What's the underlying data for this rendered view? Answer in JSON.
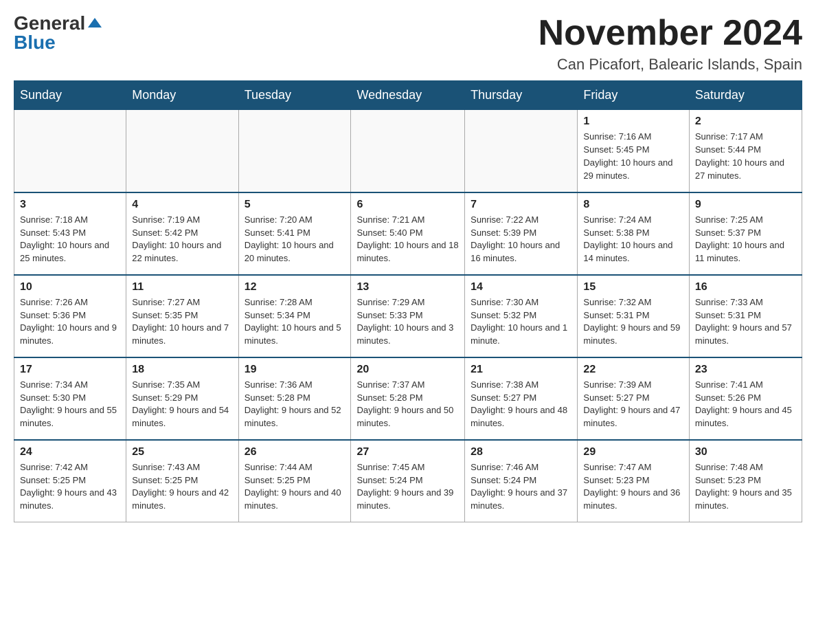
{
  "header": {
    "logo_general": "General",
    "logo_blue": "Blue",
    "month_title": "November 2024",
    "location": "Can Picafort, Balearic Islands, Spain"
  },
  "weekdays": [
    "Sunday",
    "Monday",
    "Tuesday",
    "Wednesday",
    "Thursday",
    "Friday",
    "Saturday"
  ],
  "weeks": [
    [
      {
        "day": "",
        "info": ""
      },
      {
        "day": "",
        "info": ""
      },
      {
        "day": "",
        "info": ""
      },
      {
        "day": "",
        "info": ""
      },
      {
        "day": "",
        "info": ""
      },
      {
        "day": "1",
        "info": "Sunrise: 7:16 AM\nSunset: 5:45 PM\nDaylight: 10 hours and 29 minutes."
      },
      {
        "day": "2",
        "info": "Sunrise: 7:17 AM\nSunset: 5:44 PM\nDaylight: 10 hours and 27 minutes."
      }
    ],
    [
      {
        "day": "3",
        "info": "Sunrise: 7:18 AM\nSunset: 5:43 PM\nDaylight: 10 hours and 25 minutes."
      },
      {
        "day": "4",
        "info": "Sunrise: 7:19 AM\nSunset: 5:42 PM\nDaylight: 10 hours and 22 minutes."
      },
      {
        "day": "5",
        "info": "Sunrise: 7:20 AM\nSunset: 5:41 PM\nDaylight: 10 hours and 20 minutes."
      },
      {
        "day": "6",
        "info": "Sunrise: 7:21 AM\nSunset: 5:40 PM\nDaylight: 10 hours and 18 minutes."
      },
      {
        "day": "7",
        "info": "Sunrise: 7:22 AM\nSunset: 5:39 PM\nDaylight: 10 hours and 16 minutes."
      },
      {
        "day": "8",
        "info": "Sunrise: 7:24 AM\nSunset: 5:38 PM\nDaylight: 10 hours and 14 minutes."
      },
      {
        "day": "9",
        "info": "Sunrise: 7:25 AM\nSunset: 5:37 PM\nDaylight: 10 hours and 11 minutes."
      }
    ],
    [
      {
        "day": "10",
        "info": "Sunrise: 7:26 AM\nSunset: 5:36 PM\nDaylight: 10 hours and 9 minutes."
      },
      {
        "day": "11",
        "info": "Sunrise: 7:27 AM\nSunset: 5:35 PM\nDaylight: 10 hours and 7 minutes."
      },
      {
        "day": "12",
        "info": "Sunrise: 7:28 AM\nSunset: 5:34 PM\nDaylight: 10 hours and 5 minutes."
      },
      {
        "day": "13",
        "info": "Sunrise: 7:29 AM\nSunset: 5:33 PM\nDaylight: 10 hours and 3 minutes."
      },
      {
        "day": "14",
        "info": "Sunrise: 7:30 AM\nSunset: 5:32 PM\nDaylight: 10 hours and 1 minute."
      },
      {
        "day": "15",
        "info": "Sunrise: 7:32 AM\nSunset: 5:31 PM\nDaylight: 9 hours and 59 minutes."
      },
      {
        "day": "16",
        "info": "Sunrise: 7:33 AM\nSunset: 5:31 PM\nDaylight: 9 hours and 57 minutes."
      }
    ],
    [
      {
        "day": "17",
        "info": "Sunrise: 7:34 AM\nSunset: 5:30 PM\nDaylight: 9 hours and 55 minutes."
      },
      {
        "day": "18",
        "info": "Sunrise: 7:35 AM\nSunset: 5:29 PM\nDaylight: 9 hours and 54 minutes."
      },
      {
        "day": "19",
        "info": "Sunrise: 7:36 AM\nSunset: 5:28 PM\nDaylight: 9 hours and 52 minutes."
      },
      {
        "day": "20",
        "info": "Sunrise: 7:37 AM\nSunset: 5:28 PM\nDaylight: 9 hours and 50 minutes."
      },
      {
        "day": "21",
        "info": "Sunrise: 7:38 AM\nSunset: 5:27 PM\nDaylight: 9 hours and 48 minutes."
      },
      {
        "day": "22",
        "info": "Sunrise: 7:39 AM\nSunset: 5:27 PM\nDaylight: 9 hours and 47 minutes."
      },
      {
        "day": "23",
        "info": "Sunrise: 7:41 AM\nSunset: 5:26 PM\nDaylight: 9 hours and 45 minutes."
      }
    ],
    [
      {
        "day": "24",
        "info": "Sunrise: 7:42 AM\nSunset: 5:25 PM\nDaylight: 9 hours and 43 minutes."
      },
      {
        "day": "25",
        "info": "Sunrise: 7:43 AM\nSunset: 5:25 PM\nDaylight: 9 hours and 42 minutes."
      },
      {
        "day": "26",
        "info": "Sunrise: 7:44 AM\nSunset: 5:25 PM\nDaylight: 9 hours and 40 minutes."
      },
      {
        "day": "27",
        "info": "Sunrise: 7:45 AM\nSunset: 5:24 PM\nDaylight: 9 hours and 39 minutes."
      },
      {
        "day": "28",
        "info": "Sunrise: 7:46 AM\nSunset: 5:24 PM\nDaylight: 9 hours and 37 minutes."
      },
      {
        "day": "29",
        "info": "Sunrise: 7:47 AM\nSunset: 5:23 PM\nDaylight: 9 hours and 36 minutes."
      },
      {
        "day": "30",
        "info": "Sunrise: 7:48 AM\nSunset: 5:23 PM\nDaylight: 9 hours and 35 minutes."
      }
    ]
  ]
}
